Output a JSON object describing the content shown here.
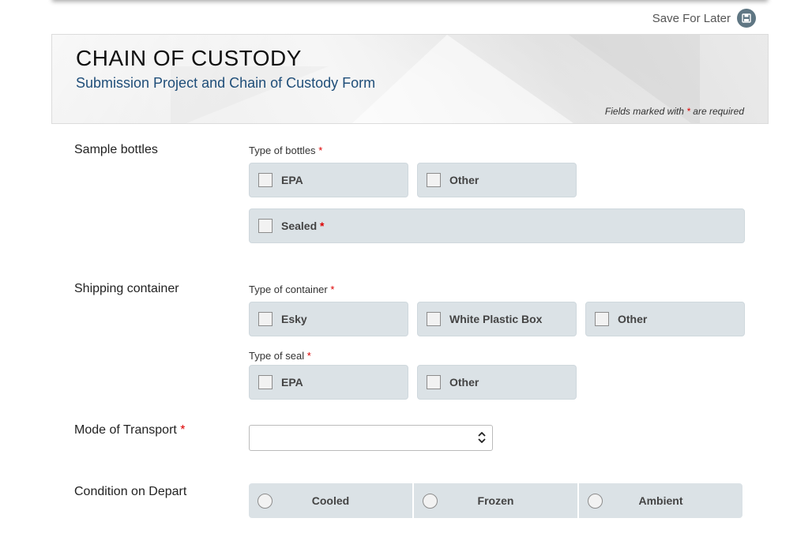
{
  "header": {
    "save_for_later": "Save For Later",
    "title": "CHAIN OF CUSTODY",
    "subtitle": "Submission Project and Chain of Custody Form",
    "required_note_prefix": "Fields marked with ",
    "required_star": "*",
    "required_note_suffix": " are required"
  },
  "sample_bottles": {
    "label": "Sample bottles",
    "type_label": "Type of bottles",
    "type_options": [
      "EPA",
      "Other"
    ],
    "sealed_label": "Sealed"
  },
  "shipping_container": {
    "label": "Shipping container",
    "container_label": "Type of container",
    "container_options": [
      "Esky",
      "White Plastic Box",
      "Other"
    ],
    "seal_label": "Type of seal",
    "seal_options": [
      "EPA",
      "Other"
    ]
  },
  "transport": {
    "label": "Mode of Transport",
    "value": ""
  },
  "condition": {
    "label": "Condition on Depart",
    "options": [
      "Cooled",
      "Frozen",
      "Ambient"
    ]
  },
  "colors": {
    "accent_title": "#1f4e79",
    "required": "#dd0000",
    "choice_bg": "#dbe2e6"
  }
}
